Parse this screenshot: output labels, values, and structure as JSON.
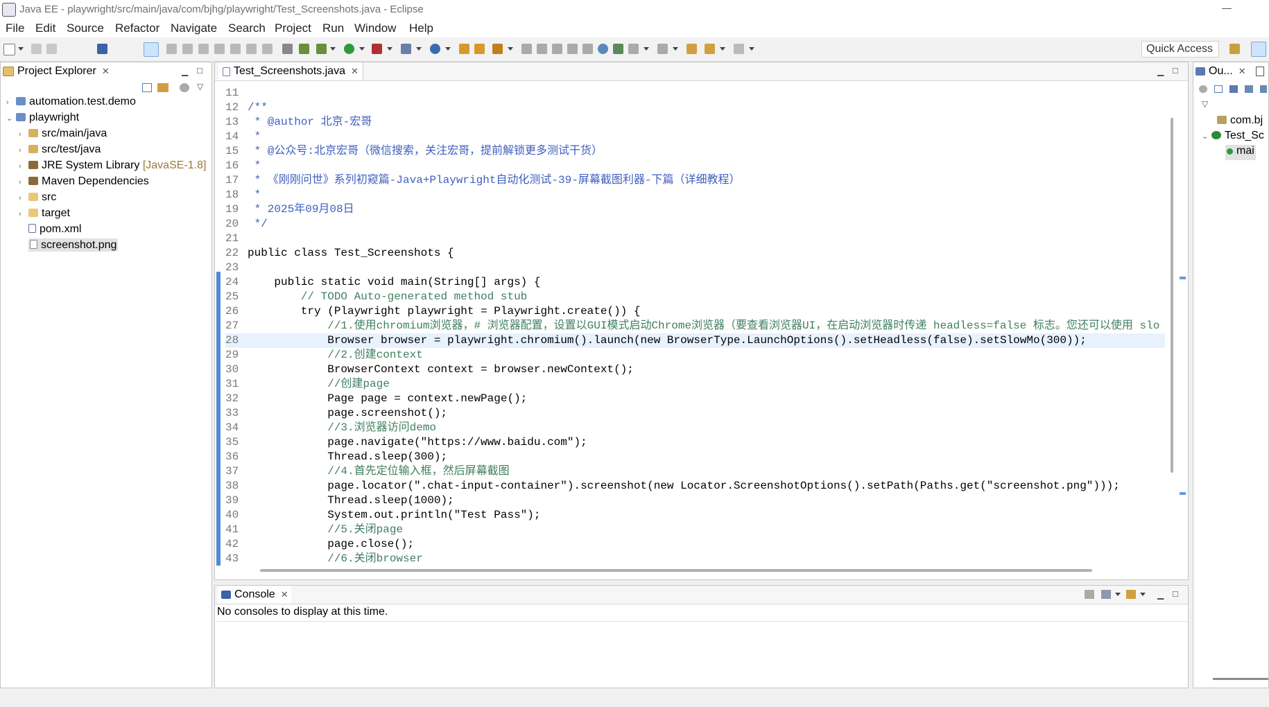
{
  "window": {
    "title": "Java EE - playwright/src/main/java/com/bjhg/playwright/Test_Screenshots.java - Eclipse"
  },
  "menu": [
    "File",
    "Edit",
    "Source",
    "Refactor",
    "Navigate",
    "Search",
    "Project",
    "Run",
    "Window",
    "Help"
  ],
  "toolbar": {
    "quick_access": "Quick Access"
  },
  "project_explorer": {
    "title": "Project Explorer",
    "items": [
      {
        "label": "automation.test.demo"
      },
      {
        "label": "playwright"
      },
      {
        "label": "src/main/java"
      },
      {
        "label": "src/test/java"
      },
      {
        "label": "JRE System Library",
        "decoration": "[JavaSE-1.8]"
      },
      {
        "label": "Maven Dependencies"
      },
      {
        "label": "src"
      },
      {
        "label": "target"
      },
      {
        "label": "pom.xml"
      },
      {
        "label": "screenshot.png"
      }
    ]
  },
  "editor": {
    "tab": "Test_Screenshots.java",
    "lines": [
      {
        "n": "11",
        "t": ""
      },
      {
        "n": "12",
        "t": "/**"
      },
      {
        "n": "13",
        "t": " * @author 北京-宏哥"
      },
      {
        "n": "14",
        "t": " *"
      },
      {
        "n": "15",
        "t": " * @公众号:北京宏哥（微信搜索，关注宏哥，提前解锁更多测试干货）"
      },
      {
        "n": "16",
        "t": " *"
      },
      {
        "n": "17",
        "t": " * 《刚刚问世》系列初窥篇-Java+Playwright自动化测试-39-屏幕截图利器-下篇（详细教程）"
      },
      {
        "n": "18",
        "t": " *"
      },
      {
        "n": "19",
        "t": " * 2025年09月08日"
      },
      {
        "n": "20",
        "t": " */"
      },
      {
        "n": "21",
        "t": ""
      },
      {
        "n": "22",
        "t": "public class Test_Screenshots {"
      },
      {
        "n": "23",
        "t": ""
      },
      {
        "n": "24",
        "t": "    public static void main(String[] args) {"
      },
      {
        "n": "25",
        "t": "        // TODO Auto-generated method stub"
      },
      {
        "n": "26",
        "t": "        try (Playwright playwright = Playwright.create()) {"
      },
      {
        "n": "27",
        "t": "            //1.使用chromium浏览器，# 浏览器配置，设置以GUI模式启动Chrome浏览器（要查看浏览器UI，在启动浏览器时传递 headless=false 标志。您还可以使用 slo"
      },
      {
        "n": "28",
        "t": "            Browser browser = playwright.chromium().launch(new BrowserType.LaunchOptions().setHeadless(false).setSlowMo(300));"
      },
      {
        "n": "29",
        "t": "            //2.创建context"
      },
      {
        "n": "30",
        "t": "            BrowserContext context = browser.newContext();"
      },
      {
        "n": "31",
        "t": "            //创建page"
      },
      {
        "n": "32",
        "t": "            Page page = context.newPage();"
      },
      {
        "n": "33",
        "t": "            page.screenshot();"
      },
      {
        "n": "34",
        "t": "            //3.浏览器访问demo"
      },
      {
        "n": "35",
        "t": "            page.navigate(\"https://www.baidu.com\");"
      },
      {
        "n": "36",
        "t": "            Thread.sleep(300);"
      },
      {
        "n": "37",
        "t": "            //4.首先定位输入框，然后屏幕截图"
      },
      {
        "n": "38",
        "t": "            page.locator(\".chat-input-container\").screenshot(new Locator.ScreenshotOptions().setPath(Paths.get(\"screenshot.png\")));"
      },
      {
        "n": "39",
        "t": "            Thread.sleep(1000);"
      },
      {
        "n": "40",
        "t": "            System.out.println(\"Test Pass\");"
      },
      {
        "n": "41",
        "t": "            //5.关闭page"
      },
      {
        "n": "42",
        "t": "            page.close();"
      },
      {
        "n": "43",
        "t": "            //6.关闭browser"
      }
    ]
  },
  "console": {
    "title": "Console",
    "message": "No consoles to display at this time."
  },
  "outline": {
    "title": "Ou...",
    "items": [
      "com.bj",
      "Test_Sc",
      "mai"
    ]
  }
}
